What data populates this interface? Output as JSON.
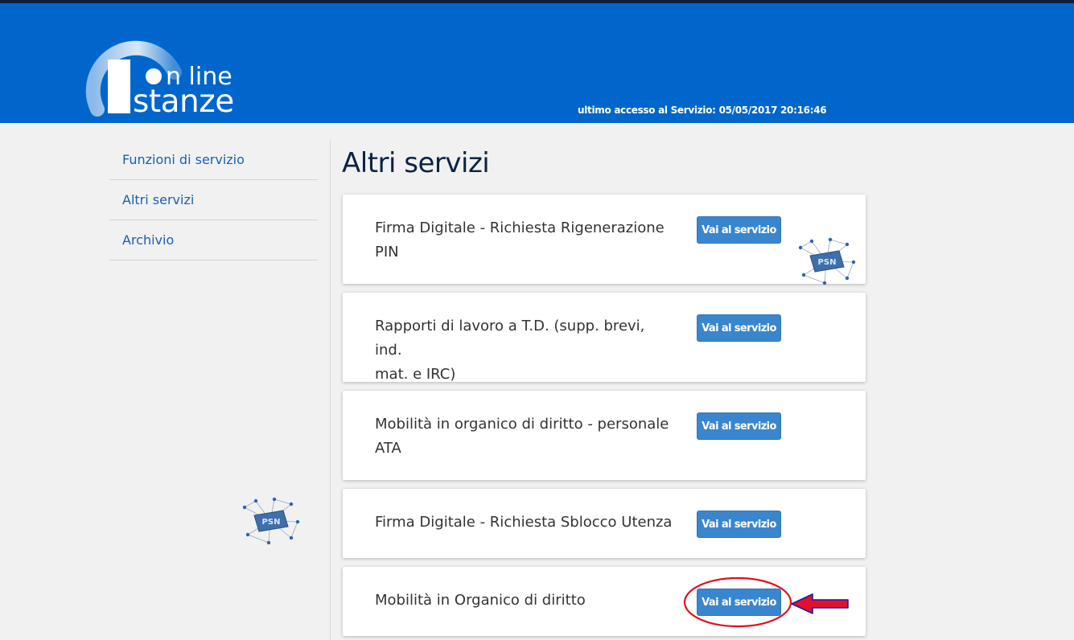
{
  "header": {
    "logo_line1": "n line",
    "logo_line2": "stanze",
    "last_access_label": "ultimo accesso al Servizio:",
    "last_access_value": "05/05/2017 20:16:46"
  },
  "sidebar": {
    "items": [
      {
        "label": "Funzioni di servizio"
      },
      {
        "label": "Altri servizi"
      },
      {
        "label": "Archivio"
      }
    ]
  },
  "main": {
    "title": "Altri servizi",
    "services": [
      {
        "title_line1": "Firma Digitale - Richiesta Rigenerazione",
        "title_line2": "PIN",
        "button": "Vai al servizio"
      },
      {
        "title_line1": "Rapporti di lavoro a T.D. (supp. brevi, ind.",
        "title_line2": "mat. e IRC)",
        "button": "Vai al servizio"
      },
      {
        "title_line1": "Mobilità in organico di diritto - personale",
        "title_line2": "ATA",
        "button": "Vai al servizio"
      },
      {
        "title_line1": "Firma Digitale - Richiesta Sblocco Utenza",
        "title_line2": "",
        "button": "Vai al servizio"
      },
      {
        "title_line1": "Mobilità in Organico di diritto",
        "title_line2": "",
        "button": "Vai al servizio"
      }
    ]
  },
  "colors": {
    "header_bg": "#0066cc",
    "button_bg": "#3a86ce",
    "link": "#1b5fb3",
    "highlight_circle": "#e0101e",
    "arrow_fill": "#e01030",
    "arrow_stroke": "#1a1aa8"
  },
  "icons": [
    "logo-ring-icon",
    "psn-network-icon",
    "annotation-circle",
    "annotation-arrow-icon"
  ]
}
